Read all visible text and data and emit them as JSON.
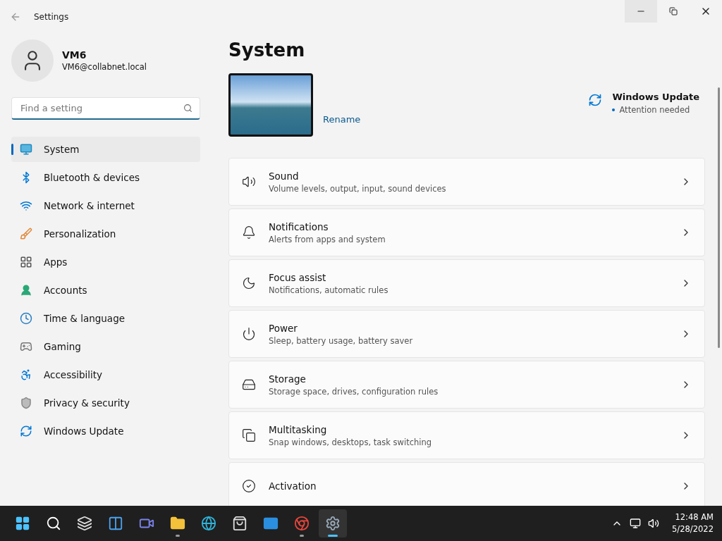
{
  "window": {
    "title": "Settings"
  },
  "account": {
    "name": "VM6",
    "email": "VM6@collabnet.local"
  },
  "search": {
    "placeholder": "Find a setting"
  },
  "sidebar": {
    "items": [
      {
        "label": "System",
        "selected": true
      },
      {
        "label": "Bluetooth & devices",
        "selected": false
      },
      {
        "label": "Network & internet",
        "selected": false
      },
      {
        "label": "Personalization",
        "selected": false
      },
      {
        "label": "Apps",
        "selected": false
      },
      {
        "label": "Accounts",
        "selected": false
      },
      {
        "label": "Time & language",
        "selected": false
      },
      {
        "label": "Gaming",
        "selected": false
      },
      {
        "label": "Accessibility",
        "selected": false
      },
      {
        "label": "Privacy & security",
        "selected": false
      },
      {
        "label": "Windows Update",
        "selected": false
      }
    ]
  },
  "page": {
    "title": "System",
    "rename": "Rename",
    "update": {
      "title": "Windows Update",
      "status": "Attention needed"
    }
  },
  "settings": [
    {
      "title": "Sound",
      "description": "Volume levels, output, input, sound devices"
    },
    {
      "title": "Notifications",
      "description": "Alerts from apps and system"
    },
    {
      "title": "Focus assist",
      "description": "Notifications, automatic rules"
    },
    {
      "title": "Power",
      "description": "Sleep, battery usage, battery saver"
    },
    {
      "title": "Storage",
      "description": "Storage space, drives, configuration rules"
    },
    {
      "title": "Multitasking",
      "description": "Snap windows, desktops, task switching"
    },
    {
      "title": "Activation"
    }
  ],
  "taskbar": {
    "apps": [
      {
        "running": false,
        "active": false
      },
      {
        "running": false,
        "active": false
      },
      {
        "running": false,
        "active": false
      },
      {
        "running": false,
        "active": false
      },
      {
        "running": false,
        "active": false
      },
      {
        "running": true,
        "active": false
      },
      {
        "running": false,
        "active": false
      },
      {
        "running": false,
        "active": false
      },
      {
        "running": false,
        "active": false
      },
      {
        "running": true,
        "active": false
      },
      {
        "running": true,
        "active": true
      }
    ],
    "time": "12:48 AM",
    "date": "5/28/2022"
  }
}
